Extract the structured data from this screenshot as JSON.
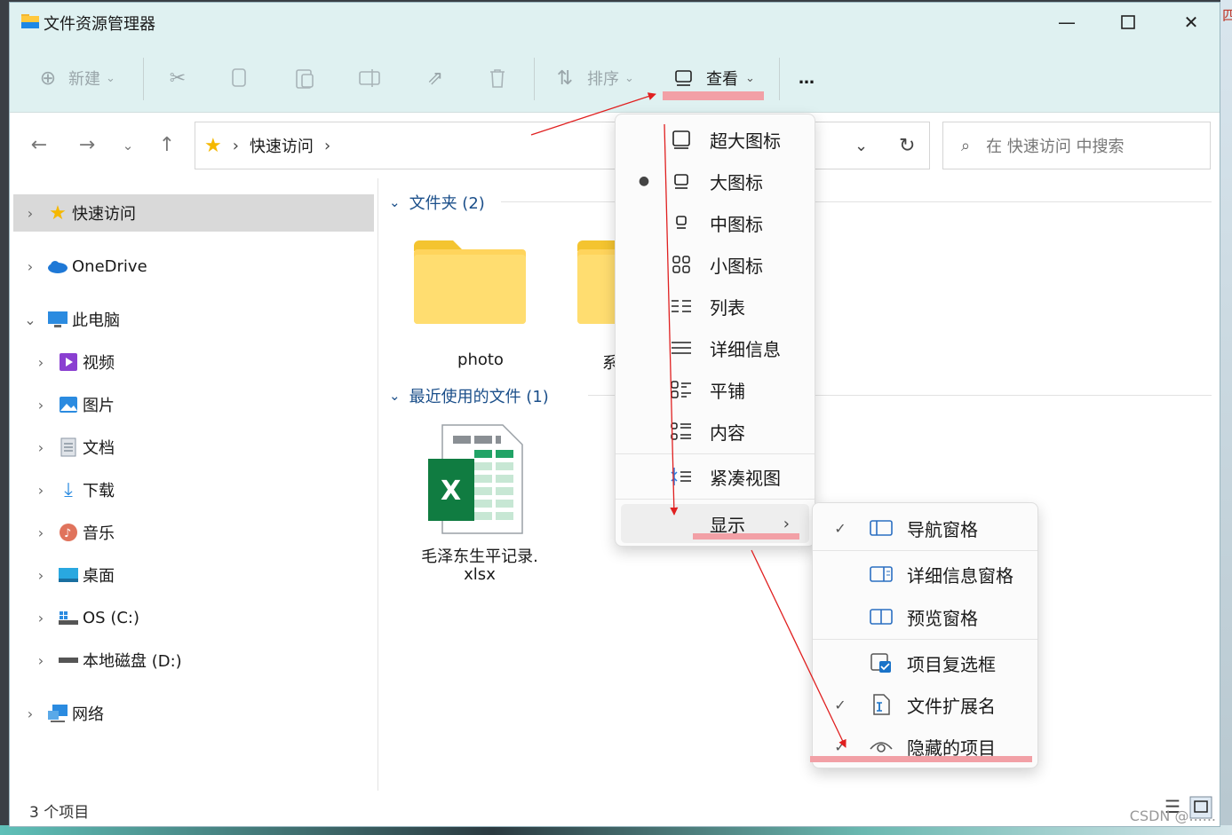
{
  "window": {
    "title": "文件资源管理器"
  },
  "toolbar": {
    "new_label": "新建",
    "sort_label": "排序",
    "view_label": "查看",
    "more_label": "…"
  },
  "address": {
    "location": "快速访问",
    "search_placeholder": "在 快速访问 中搜索"
  },
  "sidebar": {
    "items": [
      {
        "label": "快速访问",
        "icon": "star-icon",
        "selected": true
      },
      {
        "label": "OneDrive",
        "icon": "cloud-icon"
      },
      {
        "label": "此电脑",
        "icon": "computer-icon",
        "expanded": true
      },
      {
        "label": "视频",
        "icon": "video-icon"
      },
      {
        "label": "图片",
        "icon": "pictures-icon"
      },
      {
        "label": "文档",
        "icon": "documents-icon"
      },
      {
        "label": "下载",
        "icon": "download-icon"
      },
      {
        "label": "音乐",
        "icon": "music-icon"
      },
      {
        "label": "桌面",
        "icon": "desktop-icon"
      },
      {
        "label": "OS (C:)",
        "icon": "drive-c-icon"
      },
      {
        "label": "本地磁盘 (D:)",
        "icon": "drive-d-icon"
      },
      {
        "label": "网络",
        "icon": "network-icon"
      }
    ]
  },
  "content": {
    "folders_group": "文件夹 (2)",
    "recent_group": "最近使用的文件 (1)",
    "folders": [
      "photo",
      "系统"
    ],
    "recent_file_line1": "毛泽东生平记录.",
    "recent_file_line2": "xlsx"
  },
  "view_menu": {
    "items": [
      "超大图标",
      "大图标",
      "中图标",
      "小图标",
      "列表",
      "详细信息",
      "平铺",
      "内容",
      "紧凑视图",
      "显示"
    ],
    "selected": "大图标"
  },
  "show_submenu": {
    "items": [
      "导航窗格",
      "详细信息窗格",
      "预览窗格",
      "项目复选框",
      "文件扩展名",
      "隐藏的项目"
    ],
    "checked": [
      "导航窗格",
      "文件扩展名",
      "隐藏的项目"
    ]
  },
  "status": {
    "count_text": "3 个项目"
  },
  "watermark": "CSDN @......",
  "colors": {
    "accent": "#1a73c8",
    "titlebar": "#dff1f1",
    "highlight": "#f2a0a6",
    "annotation": "#e02020"
  }
}
